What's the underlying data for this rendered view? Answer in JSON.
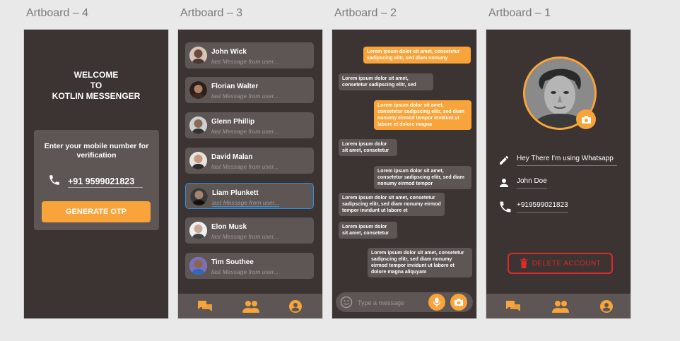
{
  "artboards": {
    "a4": {
      "title": "Artboard – 4",
      "welcome": "WELCOME\nTO\nKOTLIN MESSENGER",
      "otp_label": "Enter your mobile number for verification",
      "phone": "+91 9599021823",
      "generate_otp": "GENERATE OTP"
    },
    "a3": {
      "title": "Artboard – 3",
      "contacts": [
        {
          "name": "John Wick",
          "msg": "last Message from user..."
        },
        {
          "name": "Florian Walter",
          "msg": "last Message from user..."
        },
        {
          "name": "Glenn Phillip",
          "msg": "last Message from user..."
        },
        {
          "name": "David Malan",
          "msg": "last Message from user..."
        },
        {
          "name": "Liam Plunkett",
          "msg": "last Message from user..."
        },
        {
          "name": "Elon Musk",
          "msg": "last Message from user..."
        },
        {
          "name": "Tim Southee",
          "msg": "last Message from user..."
        }
      ]
    },
    "a2": {
      "title": "Artboard – 2",
      "messages": [
        "Lorem ipsum dolor sit amet, consetetur sadipscing elitr, sed diam nonumy",
        "Lorem ipsum dolor sit amet, consetetur sadipscing elitr, sed",
        "Lorem ipsum dolor sit amet, consetetur sadipscing elitr, sed diam nonumy eirmod tempor invidunt ut labore et dolore magna",
        "Lorem ipsum dolor sit amet, consetetur",
        "Lorem ipsum dolor sit amet, consetetur sadipscing elitr, sed diam nonumy eirmod tempor",
        "Lorem ipsum dolor sit amet, consetetur sadipscing elitr, sed diam nonumy eirmod tempor invidunt ut labore et",
        "Lorem ipsum dolor sit amet, consetetur",
        "Lorem ipsum dolor sit amet, consetetur sadipscing elitr, sed diam nonumy eirmod tempor invidunt ut labore et dolore magna aliquyam"
      ],
      "placeholder": "Type a message"
    },
    "a1": {
      "title": "Artboard – 1",
      "status": "Hey There I'm using Whatsapp",
      "name": "John Doe",
      "phone": "+919599021823",
      "delete_account": "DELETE ACCOUNT"
    }
  },
  "colors": {
    "background": "#3b3432",
    "card": "#5d5654",
    "accent": "#f9a43a",
    "danger": "#e02a2a"
  }
}
